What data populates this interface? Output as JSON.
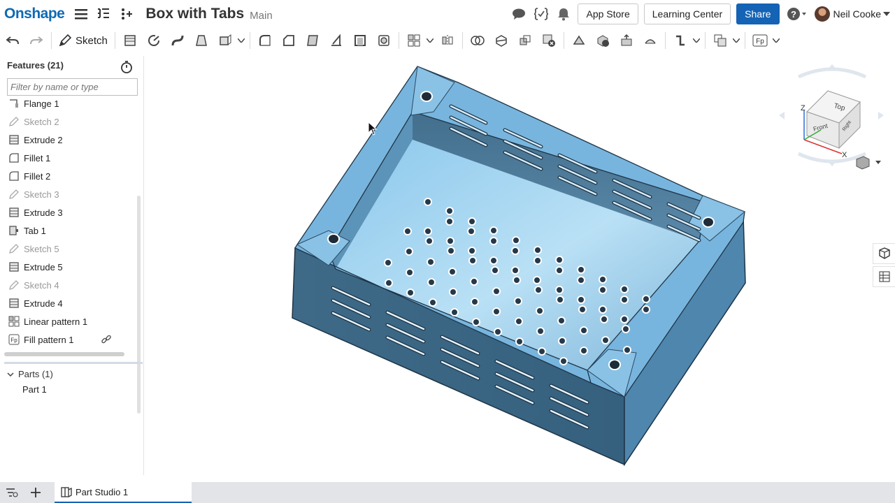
{
  "app": {
    "logo": "Onshape",
    "document_title": "Box with Tabs",
    "branch": "Main"
  },
  "topbar": {
    "app_store_label": "App Store",
    "learning_center_label": "Learning Center",
    "share_label": "Share",
    "user_name": "Neil Cooke"
  },
  "toolbar": {
    "sketch_label": "Sketch"
  },
  "features": {
    "header": "Features (21)",
    "filter_placeholder": "Filter by name or type",
    "items": [
      {
        "label": "Flange 1",
        "icon": "flange-icon",
        "suppressed": false
      },
      {
        "label": "Sketch 2",
        "icon": "sketch-icon",
        "suppressed": true
      },
      {
        "label": "Extrude 2",
        "icon": "extrude-icon",
        "suppressed": false
      },
      {
        "label": "Fillet 1",
        "icon": "fillet-icon",
        "suppressed": false
      },
      {
        "label": "Fillet 2",
        "icon": "fillet-icon",
        "suppressed": false
      },
      {
        "label": "Sketch 3",
        "icon": "sketch-icon",
        "suppressed": true
      },
      {
        "label": "Extrude 3",
        "icon": "extrude-icon",
        "suppressed": false
      },
      {
        "label": "Tab 1",
        "icon": "tab-icon",
        "suppressed": false
      },
      {
        "label": "Sketch 5",
        "icon": "sketch-icon",
        "suppressed": true
      },
      {
        "label": "Extrude 5",
        "icon": "extrude-icon",
        "suppressed": false
      },
      {
        "label": "Sketch 4",
        "icon": "sketch-icon",
        "suppressed": true
      },
      {
        "label": "Extrude 4",
        "icon": "extrude-icon",
        "suppressed": false
      },
      {
        "label": "Linear pattern 1",
        "icon": "linear-pattern-icon",
        "suppressed": false
      },
      {
        "label": "Fill pattern 1",
        "icon": "fp-icon",
        "suppressed": false
      }
    ]
  },
  "parts": {
    "header": "Parts (1)",
    "items": [
      "Part 1"
    ]
  },
  "viewcube": {
    "top_label": "Top",
    "front_label": "Front",
    "right_label": "Right",
    "z_axis": "Z",
    "x_axis": "X"
  },
  "bottom_tabs": {
    "active_tab": "Part Studio 1"
  },
  "colors": {
    "brand": "#0f6ab4",
    "share_button": "#1463b5",
    "part_blue": "#6fb3df"
  }
}
